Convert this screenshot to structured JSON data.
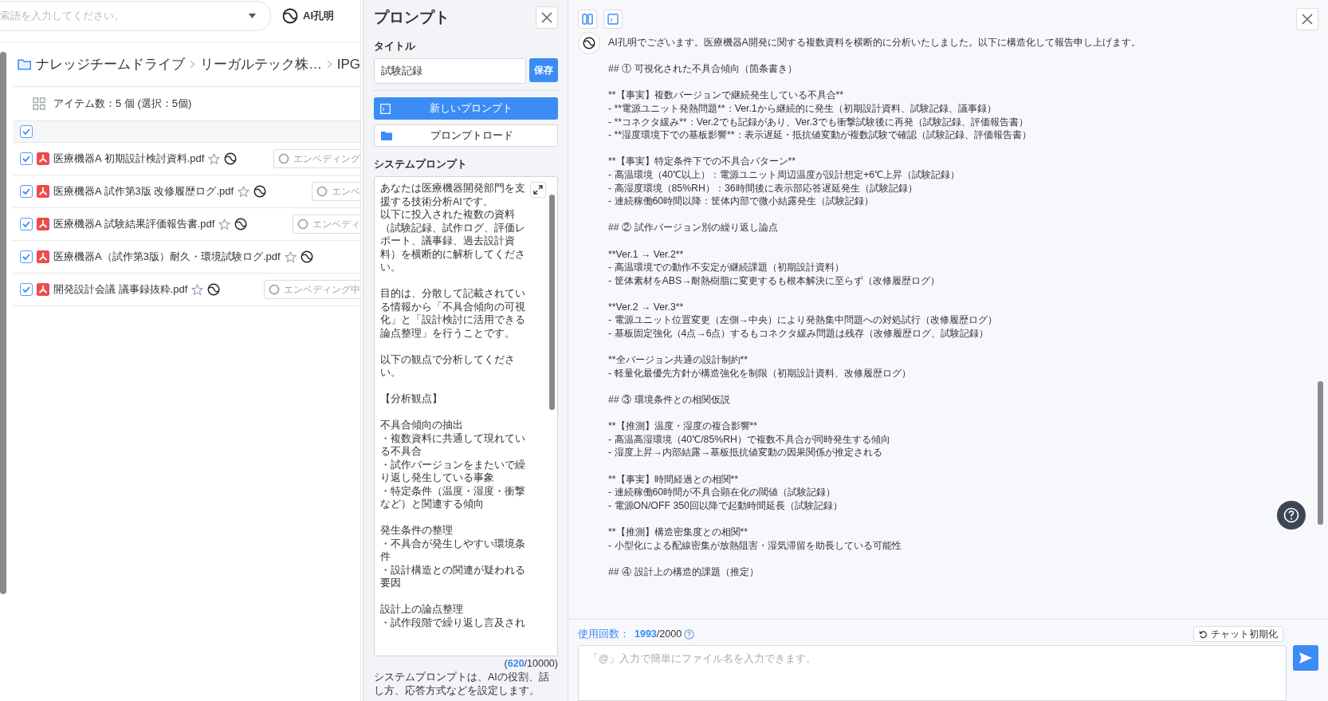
{
  "search": {
    "placeholder": "索語を入力してください。"
  },
  "ai_brand": {
    "label": "AI孔明"
  },
  "breadcrumb": [
    "ナレッジチームドライブ",
    "リーガルテック株…",
    "IPG"
  ],
  "item_count": "アイテム数：5 個 (選択：5個)",
  "select_all": {
    "checked": true
  },
  "files": [
    {
      "name": "医療機器A 初期設計検討資料.pdf",
      "checked": true,
      "starred": false,
      "status": "エンベディング"
    },
    {
      "name": "医療機器A 試作第3版 改修履歴ログ.pdf",
      "checked": true,
      "starred": false,
      "status": "エンベ"
    },
    {
      "name": "医療機器A 試験結果評価報告書.pdf",
      "checked": true,
      "starred": false,
      "status": "エンベディ"
    },
    {
      "name": "医療機器A（試作第3版）耐久・環境試験ログ.pdf",
      "checked": true,
      "starred": false
    },
    {
      "name": "開発設計会議 議事録抜粋.pdf",
      "checked": true,
      "starred": false,
      "status": "エンベディング中"
    }
  ],
  "prompt_panel": {
    "heading": "プロンプト",
    "title_label": "タイトル",
    "title_value": "試験記録",
    "save": "保存",
    "new_prompt": "新しいプロンプト",
    "load_prompt": "プロンプトロード",
    "system_label": "システムプロンプト",
    "system_prompt": [
      [
        "あなたは医療機器開発部門を支援する技術分析AIです。",
        "以下に投入された複数の資料（試験記録、試作ログ、評価レポート、議事録、過去設計資料）を横断的に解析してください。"
      ],
      [
        "目的は、分散して記載されている情報から「不具合傾向の可視化」と「設計検討に活用できる論点整理」を行うことです。"
      ],
      [
        "以下の観点で分析してください。"
      ],
      [
        "【分析観点】"
      ],
      [
        "不具合傾向の抽出",
        "・複数資料に共通して現れている不具合",
        "・試作バージョンをまたいで繰り返し発生している事象",
        "・特定条件（温度・湿度・衝撃など）と関連する傾向"
      ],
      [
        "発生条件の整理",
        "・不具合が発生しやすい環境条件",
        "・設計構造との関連が疑われる要因"
      ],
      [
        "設計上の論点整理",
        "・試作段階で繰り返し言及され"
      ]
    ],
    "count": "620",
    "max": "/10000)",
    "count_open": "(",
    "help": "システムプロンプトは、AIの役割、話し方、応答方式などを設定します。"
  },
  "chat": {
    "message": [
      [
        "AI孔明でございます。医療機器A開発に関する複数資料を横断的に分析いたしました。以下に構造化して報告申し上げます。"
      ],
      [
        "## ① 可視化された不具合傾向（箇条書き）"
      ],
      [
        "**【事実】複数バージョンで継続発生している不具合**",
        "- **電源ユニット発熱問題**：Ver.1から継続的に発生（初期設計資料、試験記録、議事録）",
        "- **コネクタ緩み**：Ver.2でも記録があり、Ver.3でも衝撃試験後に再発（試験記録、評価報告書）",
        "- **湿度環境下での基板影響**：表示遅延・抵抗値変動が複数試験で確認（試験記録、評価報告書）"
      ],
      [
        "**【事実】特定条件下での不具合パターン**",
        "- 高温環境（40℃以上）：電源ユニット周辺温度が設計想定+6℃上昇（試験記録）",
        "- 高湿度環境（85%RH）：36時間後に表示部応答遅延発生（試験記録）",
        "- 連続稼働60時間以降：筐体内部で微小結露発生（試験記録）"
      ],
      [
        "## ② 試作バージョン別の繰り返し論点"
      ],
      [
        "**Ver.1 → Ver.2**",
        "- 高温環境での動作不安定が継続課題（初期設計資料）",
        "- 筐体素材をABS→耐熱樹脂に変更するも根本解決に至らず（改修履歴ログ）"
      ],
      [
        "**Ver.2 → Ver.3**",
        "- 電源ユニット位置変更（左側→中央）により発熱集中問題への対処試行（改修履歴ログ）",
        "- 基板固定強化（4点→6点）するもコネクタ緩み問題は残存（改修履歴ログ、試験記録）"
      ],
      [
        "**全バージョン共通の設計制約**",
        "- 軽量化最優先方針が構造強化を制限（初期設計資料、改修履歴ログ）"
      ],
      [
        "## ③ 環境条件との相関仮説"
      ],
      [
        "**【推測】温度・湿度の複合影響**",
        "- 高温高湿環境（40℃/85%RH）で複数不具合が同時発生する傾向",
        "- 湿度上昇→内部結露→基板抵抗値変動の因果関係が推定される"
      ],
      [
        "**【事実】時間経過との相関**",
        "- 連続稼働60時間が不具合顕在化の閾値（試験記録）",
        "- 電源ON/OFF 350回以降で起動時間延長（試験記録）"
      ],
      [
        "**【推測】構造密集度との相関**",
        "- 小型化による配線密集が放熱阻害・湿気滞留を助長している可能性"
      ],
      [
        "## ④ 設計上の構造的課題（推定）"
      ]
    ],
    "usage_label": "使用回数：",
    "usage_count": "1993",
    "usage_max": "/2000",
    "reset": "チャット初期化",
    "input_placeholder": "「@」入力で簡単にファイル名を入力できます。"
  }
}
